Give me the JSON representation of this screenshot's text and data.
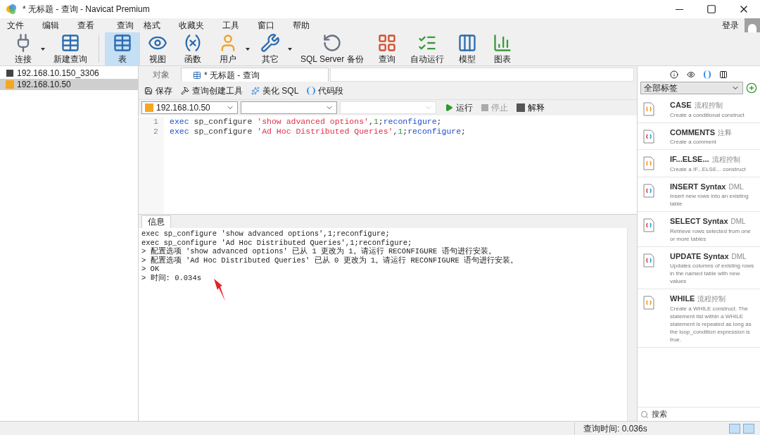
{
  "window": {
    "title": "* 无标题 - 查询 - Navicat Premium"
  },
  "menu": [
    "文件",
    "编辑",
    "查看",
    "查询",
    "格式",
    "收藏夹",
    "工具",
    "窗口",
    "帮助"
  ],
  "login": "登录",
  "toolbar": [
    {
      "label": "连接",
      "kind": "plug",
      "dropdown": true,
      "selected": false
    },
    {
      "label": "新建查询",
      "kind": "newquery",
      "dropdown": false,
      "selected": false
    },
    {
      "label": "表",
      "kind": "table",
      "dropdown": false,
      "selected": true
    },
    {
      "label": "视图",
      "kind": "view",
      "dropdown": false,
      "selected": false
    },
    {
      "label": "函数",
      "kind": "function",
      "dropdown": false,
      "selected": false
    },
    {
      "label": "用户",
      "kind": "user",
      "dropdown": true,
      "selected": false
    },
    {
      "label": "其它",
      "kind": "tools",
      "dropdown": true,
      "selected": false
    },
    {
      "label": "SQL Server 备份",
      "kind": "backup",
      "dropdown": false,
      "selected": false
    },
    {
      "label": "查询",
      "kind": "query",
      "dropdown": false,
      "selected": false
    },
    {
      "label": "自动运行",
      "kind": "schedule",
      "dropdown": false,
      "selected": false
    },
    {
      "label": "模型",
      "kind": "model",
      "dropdown": false,
      "selected": false
    },
    {
      "label": "图表",
      "kind": "chart",
      "dropdown": false,
      "selected": false
    }
  ],
  "connections": [
    {
      "name": "192.168.10.150_3306",
      "kind": "mysql",
      "selected": false
    },
    {
      "name": "192.168.10.50",
      "kind": "sqlserver",
      "selected": true
    }
  ],
  "tabs": [
    {
      "label": "对象",
      "selected": false,
      "icon": false
    },
    {
      "label": "* 无标题 - 查询",
      "selected": true,
      "icon": true
    }
  ],
  "query_toolbar": [
    {
      "label": "保存",
      "kind": "save"
    },
    {
      "label": "查询创建工具",
      "kind": "builder"
    },
    {
      "label": "美化 SQL",
      "kind": "beautify"
    },
    {
      "label": "代码段",
      "kind": "snippet"
    }
  ],
  "selectors": [
    {
      "value": "192.168.10.50"
    },
    {
      "disabled": false
    },
    {
      "disabled": true
    }
  ],
  "run_buttons": [
    {
      "label": "运行",
      "kind": "run",
      "disabled": false
    },
    {
      "label": "停止",
      "kind": "stop",
      "disabled": true
    },
    {
      "label": "解释",
      "kind": "explain",
      "disabled": false
    }
  ],
  "editor_lines": [
    {
      "number": "1",
      "tokens": [
        {
          "text": "exec",
          "kind": "keyword"
        },
        {
          "text": " sp_configure ",
          "kind": "plain"
        },
        {
          "text": "'show advanced options'",
          "kind": "string"
        },
        {
          "text": ",",
          "kind": "plain"
        },
        {
          "text": "1",
          "kind": "number"
        },
        {
          "text": ";",
          "kind": "plain"
        },
        {
          "text": "reconfigure",
          "kind": "keyword"
        },
        {
          "text": ";",
          "kind": "plain"
        }
      ]
    },
    {
      "number": "2",
      "tokens": [
        {
          "text": "exec",
          "kind": "keyword"
        },
        {
          "text": " sp_configure ",
          "kind": "plain"
        },
        {
          "text": "'Ad Hoc Distributed Queries'",
          "kind": "string"
        },
        {
          "text": ",",
          "kind": "plain"
        },
        {
          "text": "1",
          "kind": "number"
        },
        {
          "text": ";",
          "kind": "plain"
        },
        {
          "text": "reconfigure",
          "kind": "keyword"
        },
        {
          "text": ";",
          "kind": "plain"
        }
      ]
    }
  ],
  "result_tab": "信息",
  "messages": [
    "exec sp_configure 'show advanced options',1;reconfigure;",
    "exec sp_configure 'Ad Hoc Distributed Queries',1;reconfigure;",
    "> 配置选项 'show advanced options' 已从 1 更改为 1。请运行 RECONFIGURE 语句进行安装。",
    "> 配置选项 'Ad Hoc Distributed Queries' 已从 0 更改为 1。请运行 RECONFIGURE 语句进行安装。",
    "> OK",
    "> 时间: 0.034s"
  ],
  "status_bar": {
    "query_time": "查询时间: 0.036s"
  },
  "snippet_panel": {
    "filter": "全部标签",
    "search_placeholder": "搜索",
    "snippets": [
      {
        "title": "CASE",
        "tag": "流程控制",
        "description": "Create a conditional construct",
        "kind": "flow"
      },
      {
        "title": "COMMENTS",
        "tag": "注释",
        "description": "Create a comment",
        "kind": "multi"
      },
      {
        "title": "IF...ELSE...",
        "tag": "流程控制",
        "description": "Create a IF...ELSE... construct",
        "kind": "flow"
      },
      {
        "title": "INSERT Syntax",
        "tag": "DML",
        "description": "Insert new rows into an existing table",
        "kind": "multi"
      },
      {
        "title": "SELECT Syntax",
        "tag": "DML",
        "description": "Retrieve rows selected from one or more tables",
        "kind": "multi"
      },
      {
        "title": "UPDATE Syntax",
        "tag": "DML",
        "description": "Updates columns of existing rows in the named table with new values",
        "kind": "multi"
      },
      {
        "title": "WHILE",
        "tag": "流程控制",
        "description": "Create a WHILE construct. The statement list within a WHILE statement is repeated as long as the loop_condition expression is true.",
        "kind": "flow"
      }
    ]
  }
}
